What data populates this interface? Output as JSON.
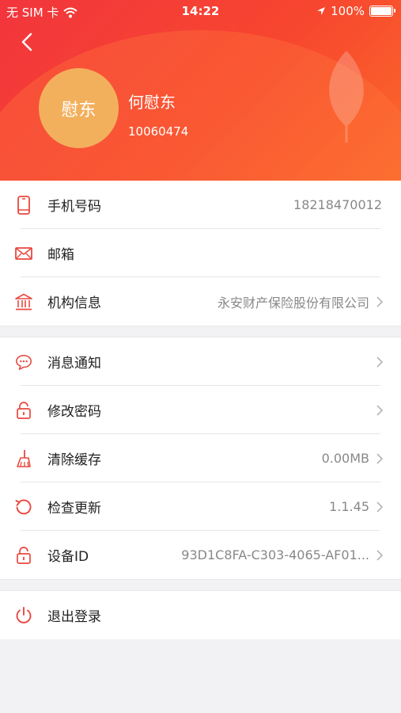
{
  "status_bar": {
    "carrier": "无 SIM 卡",
    "time": "14:22",
    "battery": "100%"
  },
  "profile": {
    "avatar_text": "慰东",
    "name": "何慰东",
    "id": "10060474"
  },
  "group1": [
    {
      "icon": "phone-icon",
      "label": "手机号码",
      "value": "18218470012",
      "arrow": false
    },
    {
      "icon": "mail-icon",
      "label": "邮箱",
      "value": "",
      "arrow": false
    },
    {
      "icon": "bank-icon",
      "label": "机构信息",
      "value": "永安财产保险股份有限公司",
      "arrow": true
    }
  ],
  "group2": [
    {
      "icon": "message-icon",
      "label": "消息通知",
      "value": "",
      "arrow": true
    },
    {
      "icon": "lock-icon",
      "label": "修改密码",
      "value": "",
      "arrow": true
    },
    {
      "icon": "broom-icon",
      "label": "清除缓存",
      "value": "0.00MB",
      "arrow": true
    },
    {
      "icon": "refresh-icon",
      "label": "检查更新",
      "value": "1.1.45",
      "arrow": true
    },
    {
      "icon": "lock-icon",
      "label": "设备ID",
      "value": "93D1C8FA-C303-4065-AF01...",
      "arrow": true
    }
  ],
  "logout": {
    "icon": "power-icon",
    "label": "退出登录"
  },
  "colors": {
    "accent": "#e8483f",
    "header_start": "#f2353d",
    "header_end": "#fb6a2a",
    "avatar": "#f3b05c"
  }
}
